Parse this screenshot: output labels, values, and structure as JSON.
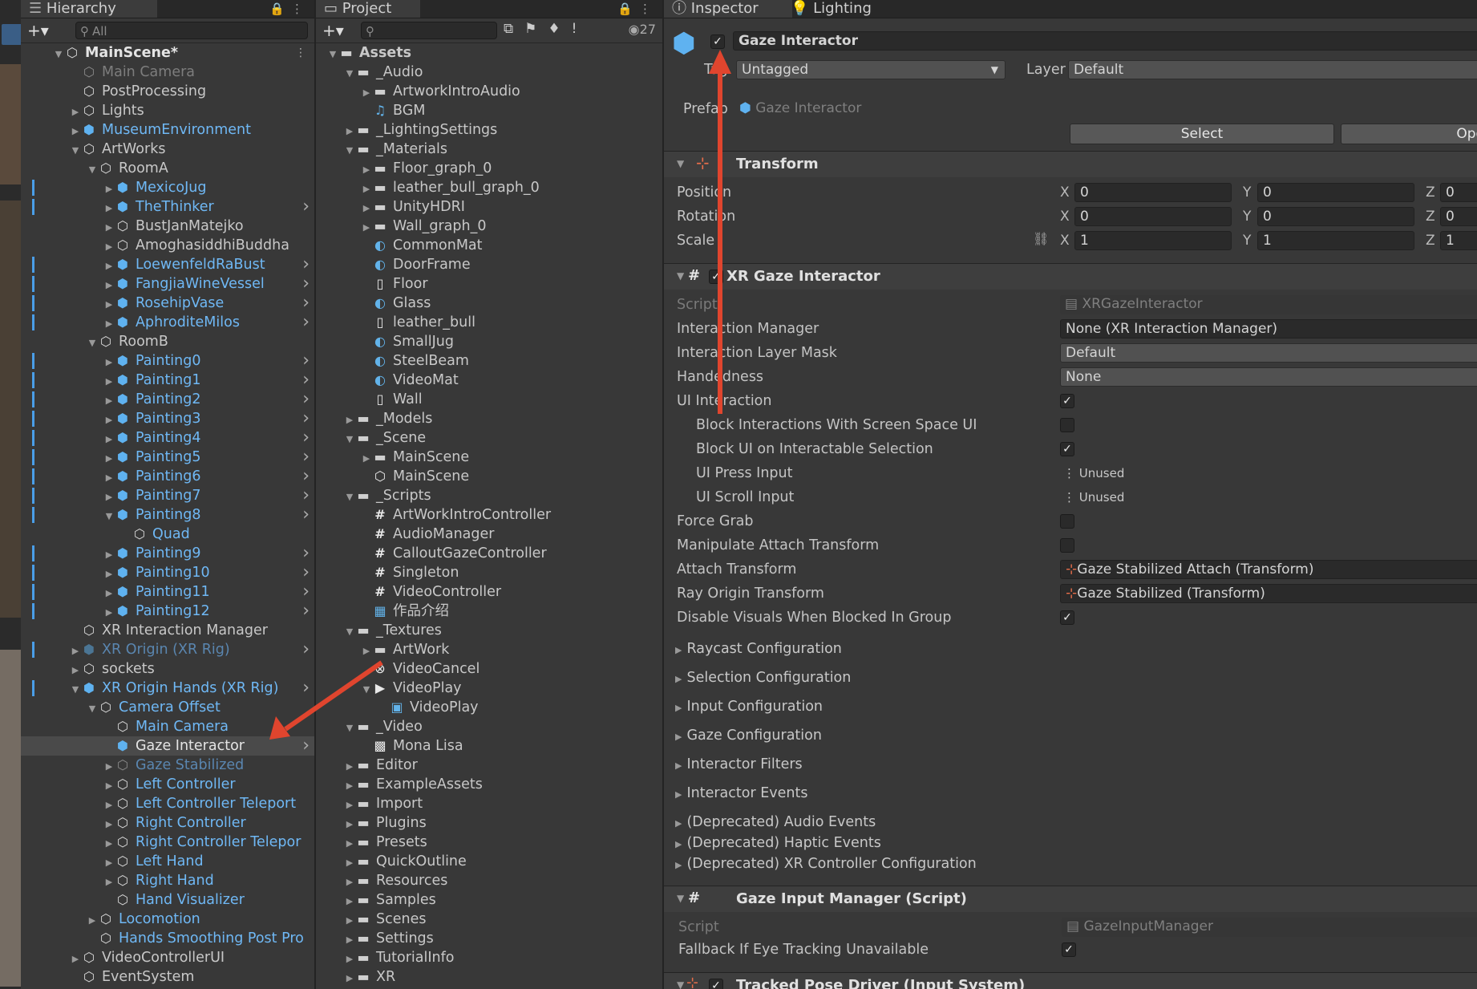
{
  "hierarchy": {
    "tab_label": "Hierarchy",
    "search_placeholder": "All",
    "rows": [
      {
        "label": "MainScene*",
        "depth": 0,
        "tri": "open",
        "icon": "unity-scene-icon",
        "style": "white",
        "bold": true
      },
      {
        "label": "Main Camera",
        "depth": 1,
        "tri": "",
        "icon": "gameobject-icon",
        "style": "dim"
      },
      {
        "label": "PostProcessing",
        "depth": 1,
        "tri": "",
        "icon": "gameobject-icon",
        "style": "normal"
      },
      {
        "label": "Lights",
        "depth": 1,
        "tri": "closed",
        "icon": "gameobject-icon",
        "style": "normal"
      },
      {
        "label": "MuseumEnvironment",
        "depth": 1,
        "tri": "closed",
        "icon": "prefab-icon",
        "style": "blue"
      },
      {
        "label": "ArtWorks",
        "depth": 1,
        "tri": "open",
        "icon": "gameobject-icon",
        "style": "normal"
      },
      {
        "label": "RoomA",
        "depth": 2,
        "tri": "open",
        "icon": "gameobject-icon",
        "style": "normal"
      },
      {
        "label": "MexicoJug",
        "depth": 3,
        "tri": "closed",
        "icon": "prefab-variant-icon",
        "style": "blue",
        "bar": true
      },
      {
        "label": "TheThinker",
        "depth": 3,
        "tri": "closed",
        "icon": "prefab-icon",
        "style": "blue",
        "bar": true,
        "chev": true
      },
      {
        "label": "BustJanMatejko",
        "depth": 3,
        "tri": "closed",
        "icon": "gameobject-icon",
        "style": "normal"
      },
      {
        "label": "AmoghasiddhiBuddha",
        "depth": 3,
        "tri": "closed",
        "icon": "gameobject-icon",
        "style": "normal"
      },
      {
        "label": "LoewenfeldRaBust",
        "depth": 3,
        "tri": "closed",
        "icon": "prefab-icon",
        "style": "blue",
        "bar": true,
        "chev": true
      },
      {
        "label": "FangjiaWineVessel",
        "depth": 3,
        "tri": "closed",
        "icon": "prefab-icon",
        "style": "blue",
        "bar": true,
        "chev": true
      },
      {
        "label": "RosehipVase",
        "depth": 3,
        "tri": "closed",
        "icon": "prefab-icon",
        "style": "blue",
        "bar": true,
        "chev": true
      },
      {
        "label": "AphroditeMilos",
        "depth": 3,
        "tri": "closed",
        "icon": "prefab-icon",
        "style": "blue",
        "bar": true,
        "chev": true
      },
      {
        "label": "RoomB",
        "depth": 2,
        "tri": "open",
        "icon": "gameobject-icon",
        "style": "normal"
      },
      {
        "label": "Painting0",
        "depth": 3,
        "tri": "closed",
        "icon": "prefab-variant-icon",
        "style": "blue",
        "bar": true,
        "chev": true
      },
      {
        "label": "Painting1",
        "depth": 3,
        "tri": "closed",
        "icon": "prefab-icon",
        "style": "blue",
        "bar": true,
        "chev": true
      },
      {
        "label": "Painting2",
        "depth": 3,
        "tri": "closed",
        "icon": "prefab-icon",
        "style": "blue",
        "bar": true,
        "chev": true
      },
      {
        "label": "Painting3",
        "depth": 3,
        "tri": "closed",
        "icon": "prefab-icon",
        "style": "blue",
        "bar": true,
        "chev": true
      },
      {
        "label": "Painting4",
        "depth": 3,
        "tri": "closed",
        "icon": "prefab-icon",
        "style": "blue",
        "bar": true,
        "chev": true
      },
      {
        "label": "Painting5",
        "depth": 3,
        "tri": "closed",
        "icon": "prefab-icon",
        "style": "blue",
        "bar": true,
        "chev": true
      },
      {
        "label": "Painting6",
        "depth": 3,
        "tri": "closed",
        "icon": "prefab-icon",
        "style": "blue",
        "bar": true,
        "chev": true
      },
      {
        "label": "Painting7",
        "depth": 3,
        "tri": "closed",
        "icon": "prefab-icon",
        "style": "blue",
        "bar": true,
        "chev": true
      },
      {
        "label": "Painting8",
        "depth": 3,
        "tri": "open",
        "icon": "prefab-icon",
        "style": "blue",
        "bar": true,
        "chev": true
      },
      {
        "label": "Quad",
        "depth": 4,
        "tri": "",
        "icon": "gameobject-icon",
        "style": "blue"
      },
      {
        "label": "Painting9",
        "depth": 3,
        "tri": "closed",
        "icon": "prefab-icon",
        "style": "blue",
        "bar": true,
        "chev": true
      },
      {
        "label": "Painting10",
        "depth": 3,
        "tri": "closed",
        "icon": "prefab-icon",
        "style": "blue",
        "bar": true,
        "chev": true
      },
      {
        "label": "Painting11",
        "depth": 3,
        "tri": "closed",
        "icon": "prefab-icon",
        "style": "blue",
        "bar": true,
        "chev": true
      },
      {
        "label": "Painting12",
        "depth": 3,
        "tri": "closed",
        "icon": "prefab-icon",
        "style": "blue",
        "bar": true,
        "chev": true
      },
      {
        "label": "XR Interaction Manager",
        "depth": 1,
        "tri": "",
        "icon": "gameobject-icon",
        "style": "normal"
      },
      {
        "label": "XR Origin (XR Rig)",
        "depth": 1,
        "tri": "closed",
        "icon": "prefab-icon",
        "style": "dimblue",
        "bar": true,
        "chev": true
      },
      {
        "label": "sockets",
        "depth": 1,
        "tri": "closed",
        "icon": "gameobject-icon",
        "style": "normal"
      },
      {
        "label": "XR Origin Hands (XR Rig)",
        "depth": 1,
        "tri": "open",
        "icon": "prefab-variant-icon",
        "style": "blue",
        "bar": true,
        "chev": true
      },
      {
        "label": "Camera Offset",
        "depth": 2,
        "tri": "open",
        "icon": "gameobject-icon",
        "style": "blue"
      },
      {
        "label": "Main Camera",
        "depth": 3,
        "tri": "",
        "icon": "gameobject-icon",
        "style": "blue"
      },
      {
        "label": "Gaze Interactor",
        "depth": 3,
        "tri": "",
        "icon": "prefab-icon",
        "style": "white",
        "selected": true,
        "chev": true
      },
      {
        "label": "Gaze Stabilized",
        "depth": 3,
        "tri": "closed",
        "icon": "gameobject-icon",
        "style": "dimblue"
      },
      {
        "label": "Left Controller",
        "depth": 3,
        "tri": "closed",
        "icon": "gameobject-icon",
        "style": "blue"
      },
      {
        "label": "Left Controller Teleport",
        "depth": 3,
        "tri": "closed",
        "icon": "gameobject-icon",
        "style": "blue"
      },
      {
        "label": "Right Controller",
        "depth": 3,
        "tri": "closed",
        "icon": "gameobject-icon",
        "style": "blue"
      },
      {
        "label": "Right Controller Telepor",
        "depth": 3,
        "tri": "closed",
        "icon": "gameobject-icon",
        "style": "blue"
      },
      {
        "label": "Left Hand",
        "depth": 3,
        "tri": "closed",
        "icon": "gameobject-icon",
        "style": "blue"
      },
      {
        "label": "Right Hand",
        "depth": 3,
        "tri": "closed",
        "icon": "gameobject-icon",
        "style": "blue"
      },
      {
        "label": "Hand Visualizer",
        "depth": 3,
        "tri": "",
        "icon": "gameobject-icon",
        "style": "blue"
      },
      {
        "label": "Locomotion",
        "depth": 2,
        "tri": "closed",
        "icon": "gameobject-icon",
        "style": "blue"
      },
      {
        "label": "Hands Smoothing Post Pro",
        "depth": 2,
        "tri": "",
        "icon": "gameobject-icon",
        "style": "blue"
      },
      {
        "label": "VideoControllerUI",
        "depth": 1,
        "tri": "closed",
        "icon": "gameobject-icon",
        "style": "normal"
      },
      {
        "label": "EventSystem",
        "depth": 1,
        "tri": "",
        "icon": "gameobject-icon",
        "style": "normal"
      }
    ]
  },
  "project": {
    "tab_label": "Project",
    "hidden_count": "27",
    "rows": [
      {
        "label": "Assets",
        "depth": 0,
        "tri": "open",
        "icon": "folder-open-icon",
        "bold": true
      },
      {
        "label": "_Audio",
        "depth": 1,
        "tri": "open",
        "icon": "folder-open-icon"
      },
      {
        "label": "ArtworkIntroAudio",
        "depth": 2,
        "tri": "closed",
        "icon": "folder-icon"
      },
      {
        "label": "BGM",
        "depth": 2,
        "tri": "",
        "icon": "audio-icon"
      },
      {
        "label": "_LightingSettings",
        "depth": 1,
        "tri": "closed",
        "icon": "folder-icon"
      },
      {
        "label": "_Materials",
        "depth": 1,
        "tri": "open",
        "icon": "folder-open-icon"
      },
      {
        "label": "Floor_graph_0",
        "depth": 2,
        "tri": "closed",
        "icon": "folder-icon"
      },
      {
        "label": "leather_bull_graph_0",
        "depth": 2,
        "tri": "closed",
        "icon": "folder-icon"
      },
      {
        "label": "UnityHDRI",
        "depth": 2,
        "tri": "closed",
        "icon": "folder-icon"
      },
      {
        "label": "Wall_graph_0",
        "depth": 2,
        "tri": "closed",
        "icon": "folder-icon"
      },
      {
        "label": "CommonMat",
        "depth": 2,
        "tri": "",
        "icon": "material-icon"
      },
      {
        "label": "DoorFrame",
        "depth": 2,
        "tri": "",
        "icon": "material-icon"
      },
      {
        "label": "Floor",
        "depth": 2,
        "tri": "",
        "icon": "file-icon"
      },
      {
        "label": "Glass",
        "depth": 2,
        "tri": "",
        "icon": "material-icon"
      },
      {
        "label": "leather_bull",
        "depth": 2,
        "tri": "",
        "icon": "file-icon"
      },
      {
        "label": "SmallJug",
        "depth": 2,
        "tri": "",
        "icon": "material-icon"
      },
      {
        "label": "SteelBeam",
        "depth": 2,
        "tri": "",
        "icon": "material-icon"
      },
      {
        "label": "VideoMat",
        "depth": 2,
        "tri": "",
        "icon": "material-icon"
      },
      {
        "label": "Wall",
        "depth": 2,
        "tri": "",
        "icon": "file-icon"
      },
      {
        "label": "_Models",
        "depth": 1,
        "tri": "closed",
        "icon": "folder-icon"
      },
      {
        "label": "_Scene",
        "depth": 1,
        "tri": "open",
        "icon": "folder-open-icon"
      },
      {
        "label": "MainScene",
        "depth": 2,
        "tri": "closed",
        "icon": "folder-icon"
      },
      {
        "label": "MainScene",
        "depth": 2,
        "tri": "",
        "icon": "unity-scene-icon"
      },
      {
        "label": "_Scripts",
        "depth": 1,
        "tri": "open",
        "icon": "folder-open-icon"
      },
      {
        "label": "ArtWorkIntroController",
        "depth": 2,
        "tri": "",
        "icon": "script-icon"
      },
      {
        "label": "AudioManager",
        "depth": 2,
        "tri": "",
        "icon": "script-icon"
      },
      {
        "label": "CalloutGazeController",
        "depth": 2,
        "tri": "",
        "icon": "script-icon"
      },
      {
        "label": "Singleton",
        "depth": 2,
        "tri": "",
        "icon": "script-icon"
      },
      {
        "label": "VideoController",
        "depth": 2,
        "tri": "",
        "icon": "script-icon"
      },
      {
        "label": "作品介绍",
        "depth": 2,
        "tri": "",
        "icon": "sheet-icon"
      },
      {
        "label": "_Textures",
        "depth": 1,
        "tri": "open",
        "icon": "folder-open-icon"
      },
      {
        "label": "ArtWork",
        "depth": 2,
        "tri": "closed",
        "icon": "folder-icon"
      },
      {
        "label": "VideoCancel",
        "depth": 2,
        "tri": "",
        "icon": "cancel-texture-icon"
      },
      {
        "label": "VideoPlay",
        "depth": 2,
        "tri": "open",
        "icon": "play-texture-icon"
      },
      {
        "label": "VideoPlay",
        "depth": 3,
        "tri": "",
        "icon": "sprite-icon"
      },
      {
        "label": "_Video",
        "depth": 1,
        "tri": "open",
        "icon": "folder-open-icon"
      },
      {
        "label": "Mona Lisa",
        "depth": 2,
        "tri": "",
        "icon": "video-clip-icon"
      },
      {
        "label": "Editor",
        "depth": 1,
        "tri": "closed",
        "icon": "folder-icon"
      },
      {
        "label": "ExampleAssets",
        "depth": 1,
        "tri": "closed",
        "icon": "folder-icon"
      },
      {
        "label": "Import",
        "depth": 1,
        "tri": "closed",
        "icon": "folder-icon"
      },
      {
        "label": "Plugins",
        "depth": 1,
        "tri": "closed",
        "icon": "folder-icon"
      },
      {
        "label": "Presets",
        "depth": 1,
        "tri": "closed",
        "icon": "folder-icon"
      },
      {
        "label": "QuickOutline",
        "depth": 1,
        "tri": "closed",
        "icon": "folder-icon"
      },
      {
        "label": "Resources",
        "depth": 1,
        "tri": "closed",
        "icon": "folder-icon"
      },
      {
        "label": "Samples",
        "depth": 1,
        "tri": "closed",
        "icon": "folder-icon"
      },
      {
        "label": "Scenes",
        "depth": 1,
        "tri": "closed",
        "icon": "folder-icon"
      },
      {
        "label": "Settings",
        "depth": 1,
        "tri": "closed",
        "icon": "folder-icon"
      },
      {
        "label": "TutorialInfo",
        "depth": 1,
        "tri": "closed",
        "icon": "folder-icon"
      },
      {
        "label": "XR",
        "depth": 1,
        "tri": "closed",
        "icon": "folder-icon"
      }
    ]
  },
  "inspector": {
    "tab_label": "Inspector",
    "tab2_label": "Lighting",
    "object_name": "Gaze Interactor",
    "tag_label": "Tag",
    "tag_value": "Untagged",
    "layer_label": "Layer",
    "layer_value": "Default",
    "prefab_label": "Prefab",
    "prefab_value": "Gaze Interactor",
    "select_button": "Select",
    "open_button": "Ope",
    "transform": {
      "title": "Transform",
      "position_label": "Position",
      "rotation_label": "Rotation",
      "scale_label": "Scale",
      "x": "X",
      "y": "Y",
      "z": "Z",
      "position": [
        "0",
        "0",
        "0"
      ],
      "rotation": [
        "0",
        "0",
        "0"
      ],
      "scale": [
        "1",
        "1",
        "1"
      ]
    },
    "xr_gaze": {
      "title": "XR Gaze Interactor",
      "script_label": "Script",
      "script_value": "XRGazeInteractor",
      "interaction_manager_label": "Interaction Manager",
      "interaction_manager_value": "None (XR Interaction Manager)",
      "layer_mask_label": "Interaction Layer Mask",
      "layer_mask_value": "Default",
      "handedness_label": "Handedness",
      "handedness_value": "None",
      "ui_interaction_label": "UI Interaction",
      "block_screen_label": "Block Interactions With Screen Space UI",
      "block_ui_label": "Block UI on Interactable Selection",
      "ui_press_label": "UI Press Input",
      "ui_press_value": "Unused",
      "ui_scroll_label": "UI Scroll Input",
      "ui_scroll_value": "Unused",
      "force_grab_label": "Force Grab",
      "manipulate_label": "Manipulate Attach Transform",
      "attach_label": "Attach Transform",
      "attach_value": "Gaze Stabilized Attach (Transform)",
      "ray_origin_label": "Ray Origin Transform",
      "ray_origin_value": "Gaze Stabilized (Transform)",
      "disable_visuals_label": "Disable Visuals When Blocked In Group",
      "foldouts": [
        "Raycast Configuration",
        "Selection Configuration",
        "Input Configuration",
        "Gaze Configuration",
        "Interactor Filters",
        "Interactor Events",
        "(Deprecated) Audio Events",
        "(Deprecated) Haptic Events",
        "(Deprecated) XR Controller Configuration"
      ]
    },
    "gaze_input": {
      "title": "Gaze Input Manager (Script)",
      "script_label": "Script",
      "script_value": "GazeInputManager",
      "fallback_label": "Fallback If Eye Tracking Unavailable"
    },
    "tracked_pose": {
      "title": "Tracked Pose Driver (Input System)"
    }
  },
  "colors": {
    "accent_blue": "#4a9ee8",
    "annotation_arrow": "#e0452e"
  }
}
